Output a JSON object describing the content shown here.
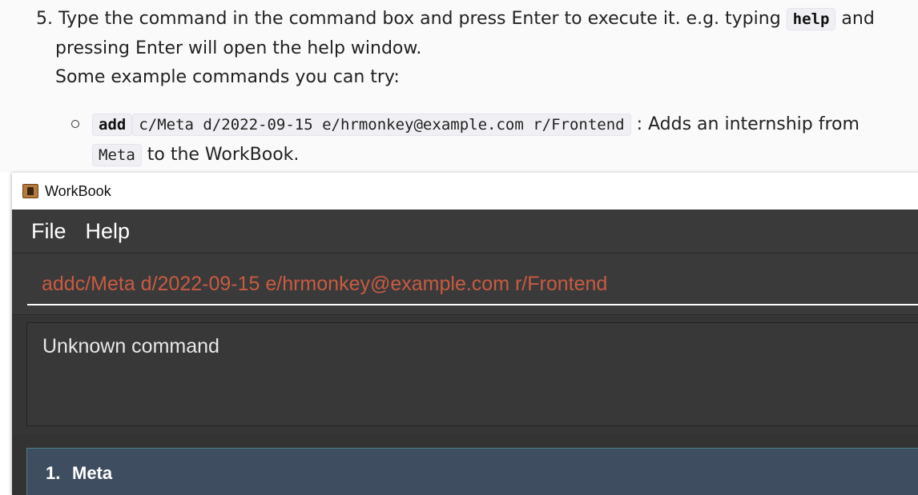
{
  "doc": {
    "step_number": "5.",
    "line1_before": "Type the command in the command box and press Enter to execute it. e.g. typing ",
    "line1_code": "help",
    "line1_after": " and",
    "line2": "pressing Enter will open the help window.",
    "line3": "Some example commands you can try:",
    "example": {
      "cmd_keyword": "add",
      "cmd_args": "c/Meta d/2022-09-15 e/hrmonkey@example.com r/Frontend",
      "desc_before": " : Adds an internship from",
      "desc_code": "Meta",
      "desc_after": " to the WorkBook."
    }
  },
  "window": {
    "title": "WorkBook",
    "icon": "address-book-icon",
    "menu": [
      {
        "label": "File"
      },
      {
        "label": "Help"
      }
    ],
    "command_box": {
      "value": "addc/Meta d/2022-09-15 e/hrmonkey@example.com r/Frontend"
    },
    "result": {
      "text": "Unknown command"
    },
    "list": [
      {
        "index": "1.",
        "name": "Meta"
      }
    ]
  },
  "colors": {
    "command_text": "#c85b40",
    "app_background": "#353535",
    "card_background": "#3f4d60"
  }
}
